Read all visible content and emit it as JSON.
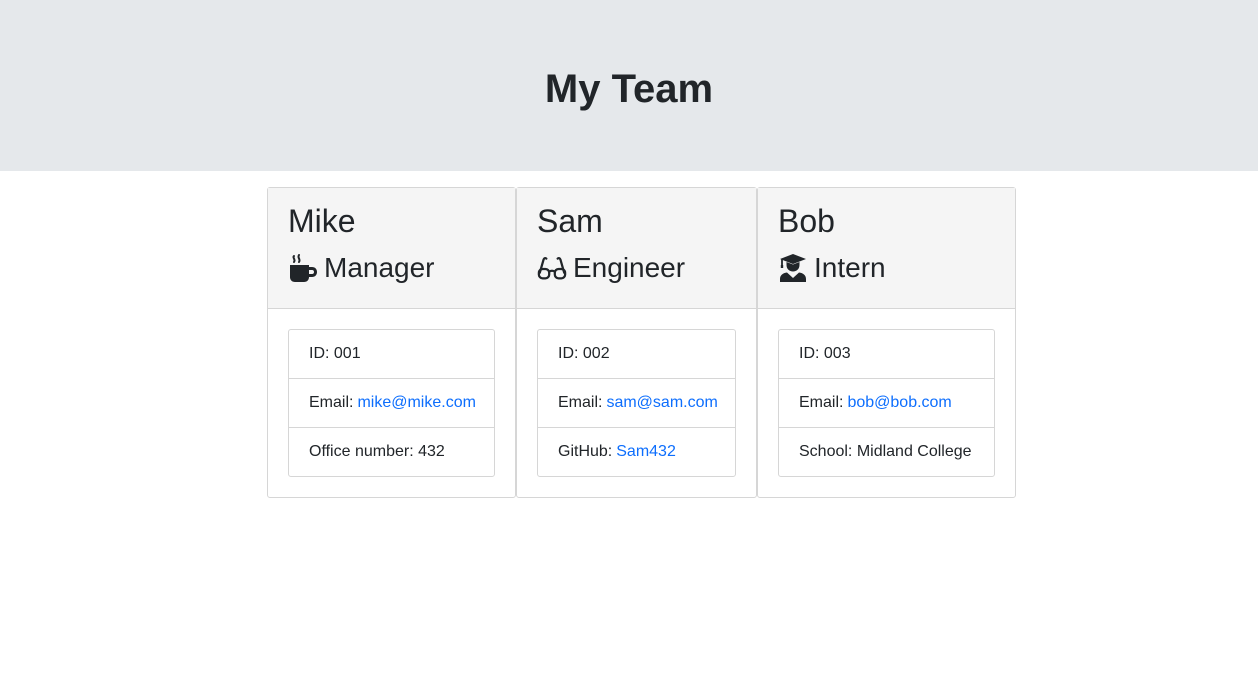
{
  "header": {
    "title": "My Team"
  },
  "colors": {
    "link": "#0d6efd",
    "jumbotron_bg": "#e5e8eb",
    "card_header_bg": "#f5f5f5"
  },
  "members": [
    {
      "name": "Mike",
      "role": "Manager",
      "icon": "coffee-mug-icon",
      "id_label": "ID: 001",
      "email_prefix": "Email:",
      "email": "mike@mike.com",
      "extra_label": "Office number: 432"
    },
    {
      "name": "Sam",
      "role": "Engineer",
      "icon": "glasses-icon",
      "id_label": "ID: 002",
      "email_prefix": "Email:",
      "email": "sam@sam.com",
      "extra_prefix": "GitHub:",
      "extra_link": "Sam432"
    },
    {
      "name": "Bob",
      "role": "Intern",
      "icon": "graduate-icon",
      "id_label": "ID: 003",
      "email_prefix": "Email:",
      "email": "bob@bob.com",
      "extra_label": "School: Midland College"
    }
  ]
}
